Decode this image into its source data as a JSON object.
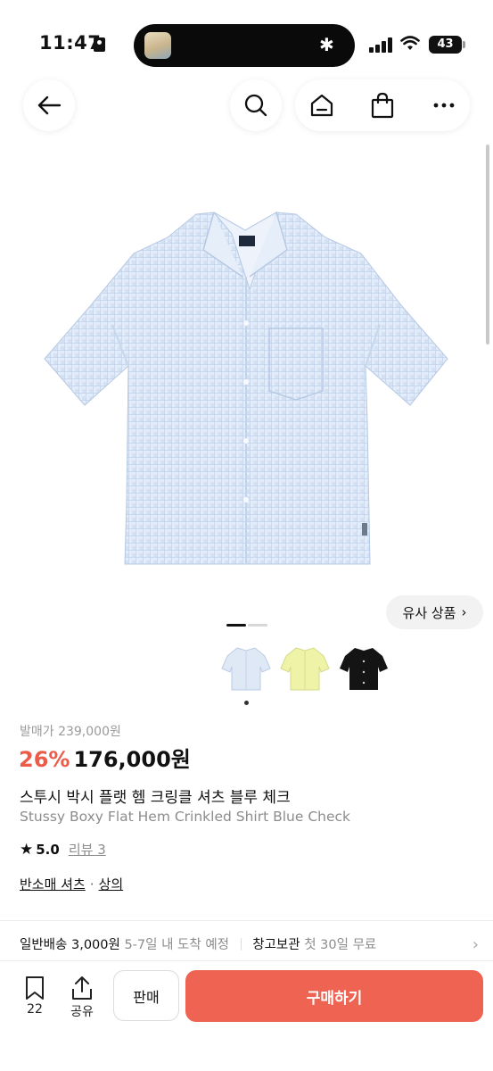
{
  "status_bar": {
    "time": "11:47",
    "battery": "43"
  },
  "nav": {
    "back_icon": "arrow-left-icon",
    "icons": [
      "search-icon",
      "home-icon",
      "shopping-bag-icon",
      "more-icon"
    ]
  },
  "product": {
    "image": "light blue checked short-sleeve shirt",
    "similar_label": "유사 상품",
    "original_price": "발매가 239,000원",
    "discount": "26%",
    "price": "176,000원",
    "title_ko": "스투시 박시 플랫 헴 크링클 셔츠 블루 체크",
    "title_en": "Stussy Boxy Flat Hem Crinkled Shirt Blue Check",
    "rating": "5.0",
    "review_label": "리뷰 3",
    "categories": [
      "반소매 셔츠",
      "상의"
    ],
    "category_separator": "·"
  },
  "swatches": [
    {
      "name": "blue",
      "color": "#dfe9f5"
    },
    {
      "name": "yellow",
      "color": "#eef3a8"
    },
    {
      "name": "black",
      "color": "#141414"
    }
  ],
  "carousel": {
    "active_index": 0,
    "count": 2
  },
  "shipping": {
    "label": "일반배송",
    "price": "3,000원",
    "eta": "5-7일 내 도착 예정",
    "storage_label": "창고보관",
    "storage_note": "첫 30일 무료"
  },
  "bottom_bar": {
    "bookmark_count": "22",
    "share_label": "공유",
    "sell_label": "판매",
    "buy_label": "구매하기"
  },
  "colors": {
    "accent": "#ee6352",
    "discount": "#ec5a48",
    "muted_text": "#8c8c8c"
  }
}
